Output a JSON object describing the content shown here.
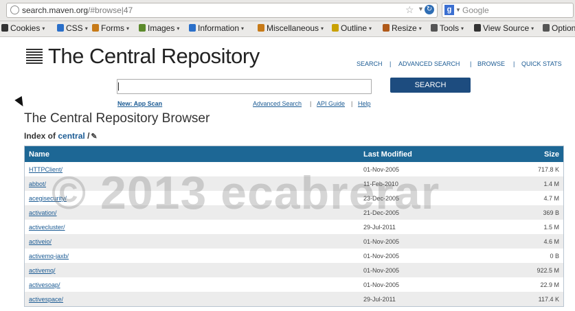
{
  "browser": {
    "url_host": "search.maven.org",
    "url_path": "/#browse|47",
    "search_engine_placeholder": "Google"
  },
  "toolbar": [
    {
      "label": "Cookies",
      "color": "#333333"
    },
    {
      "label": "CSS",
      "color": "#2a6fc9"
    },
    {
      "label": "Forms",
      "color": "#c77a18"
    },
    {
      "label": "Images",
      "color": "#5b8a2b"
    },
    {
      "label": "Information",
      "color": "#2a6fc9"
    },
    {
      "label": "Miscellaneous",
      "color": "#c77a18"
    },
    {
      "label": "Outline",
      "color": "#c9a100"
    },
    {
      "label": "Resize",
      "color": "#b05a1a"
    },
    {
      "label": "Tools",
      "color": "#555555"
    },
    {
      "label": "View Source",
      "color": "#333333"
    },
    {
      "label": "Options",
      "color": "#555555"
    }
  ],
  "site": {
    "title": "The Central Repository",
    "nav": [
      "SEARCH",
      "ADVANCED SEARCH",
      "BROWSE",
      "QUICK STATS"
    ],
    "search_button": "SEARCH",
    "sublinks": {
      "new": "New: App Scan",
      "advanced": "Advanced Search",
      "api": "API Guide",
      "help": "Help"
    }
  },
  "browser_section": {
    "title": "The Central Repository Browser",
    "index_prefix": "Index of",
    "crumb": "central",
    "suffix": "/"
  },
  "table": {
    "headers": {
      "name": "Name",
      "modified": "Last Modified",
      "size": "Size"
    },
    "rows": [
      {
        "name": "HTTPClient/",
        "modified": "01-Nov-2005",
        "size": "717.8 K"
      },
      {
        "name": "abbot/",
        "modified": "11-Feb-2010",
        "size": "1.4 M"
      },
      {
        "name": "acegisecurity/",
        "modified": "23-Dec-2005",
        "size": "4.7 M"
      },
      {
        "name": "activation/",
        "modified": "21-Dec-2005",
        "size": "369 B"
      },
      {
        "name": "activecluster/",
        "modified": "29-Jul-2011",
        "size": "1.5 M"
      },
      {
        "name": "activeio/",
        "modified": "01-Nov-2005",
        "size": "4.6 M"
      },
      {
        "name": "activemq-jaxb/",
        "modified": "01-Nov-2005",
        "size": "0 B"
      },
      {
        "name": "activemq/",
        "modified": "01-Nov-2005",
        "size": "922.5 M"
      },
      {
        "name": "activesoap/",
        "modified": "01-Nov-2005",
        "size": "22.9 M"
      },
      {
        "name": "activespace/",
        "modified": "29-Jul-2011",
        "size": "117.4 K"
      }
    ]
  },
  "watermark": "© 2013 ecabrerar"
}
